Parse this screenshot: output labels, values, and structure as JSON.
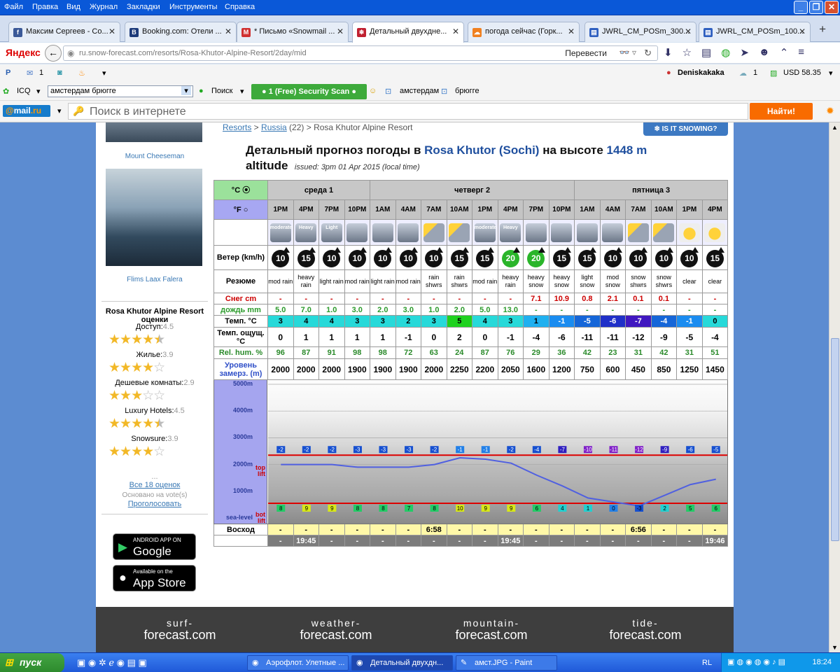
{
  "menu": [
    "Файл",
    "Правка",
    "Вид",
    "Журнал",
    "Закладки",
    "Инструменты",
    "Справка"
  ],
  "tabs": [
    {
      "label": "Максим Сергеев - Со...",
      "icon": "facebook-icon",
      "color": "#3b5998",
      "glyph": "f"
    },
    {
      "label": "Booking.com: Отели ...",
      "icon": "booking-icon",
      "color": "#1d3b7a",
      "glyph": "B"
    },
    {
      "label": "* Письмо «Snowmail ...",
      "icon": "mail-icon",
      "color": "#d03030",
      "glyph": "M"
    },
    {
      "label": "Детальный двухдне...",
      "icon": "snow-forecast-icon",
      "color": "#c02030",
      "glyph": "❄"
    },
    {
      "label": "погода сейчас (Горк...",
      "icon": "weather-icon",
      "color": "#f08020",
      "glyph": "☁"
    },
    {
      "label": "JWRL_CM_POSm_300...",
      "icon": "document-icon",
      "color": "#3060c0",
      "glyph": "▤"
    },
    {
      "label": "JWRL_CM_POSm_100...",
      "icon": "document-icon",
      "color": "#3060c0",
      "glyph": "▤"
    }
  ],
  "nav": {
    "yandex": "Яндекс",
    "url": "ru.snow-forecast.com/resorts/Rosa-Khutor-Alpine-Resort/2day/mid",
    "translate": "Перевести"
  },
  "bookmarks": {
    "mail_count": "1",
    "user": "Deniskakaka",
    "cloud_count": "1",
    "usd": "USD 58.35"
  },
  "toolbar3": {
    "icq": "ICQ",
    "search_select": "амстердам брюгге",
    "search": "Поиск",
    "security": "● 1 (Free) Security Scan ●",
    "q1": "амстердам",
    "q2": "брюгге"
  },
  "mailbar": {
    "logo_at": "@",
    "logo_rest": "mail",
    "logo_ru": ".ru",
    "search_placeholder": "Поиск в интернете",
    "find": "Найти!"
  },
  "left": {
    "cap1": "Mount Cheeseman",
    "cap2": "Flims Laax Falera",
    "rating_title": "Rosa Khutor Alpine Resort оценки",
    "ratings": [
      {
        "label": "Доступ:",
        "value": "4.5",
        "stars": 4.5
      },
      {
        "label": "Жилье:",
        "value": "3.9",
        "stars": 4
      },
      {
        "label": "Дешевые комнаты:",
        "value": "2.9",
        "stars": 3
      },
      {
        "label": "Luxury Hotels:",
        "value": "4.5",
        "stars": 4.5
      },
      {
        "label": "Snowsure:",
        "value": "3.9",
        "stars": 4
      }
    ],
    "dots": "...",
    "all": "Все 18 оценок",
    "based": "Основано на vote(s)",
    "vote": "Проголосовать",
    "android_small": "ANDROID APP ON",
    "android_big": "Google play",
    "apple_small": "Available on the",
    "apple_big": "App Store"
  },
  "header": {
    "crumb1": "Resorts",
    "sep1": " > ",
    "crumb2": "Russia",
    "count": " (22) > ",
    "crumb3": "Rosa Khutor Alpine Resort",
    "snowing": "❄ IS IT SNOWING?",
    "title_a": "Детальный прогноз погоды в ",
    "title_b": "Rosa Khutor (Sochi)",
    "title_c": " на высоте ",
    "title_d": "1448 m",
    "title_e": "altitude",
    "issued": "issued: 3pm 01 Apr 2015 (local time)"
  },
  "fc": {
    "unit_c": "°C ⦿",
    "unit_f": "°F ○",
    "days": [
      {
        "label": "среда 1",
        "span": 4
      },
      {
        "label": "четверг 2",
        "span": 8
      },
      {
        "label": "пятница 3",
        "span": 6
      }
    ],
    "times": [
      "1PM",
      "4PM",
      "7PM",
      "10PM",
      "1AM",
      "4AM",
      "7AM",
      "10AM",
      "1PM",
      "4PM",
      "7PM",
      "10PM",
      "1AM",
      "4AM",
      "7AM",
      "10AM",
      "1PM",
      "4PM"
    ],
    "icons": [
      "moderate",
      "heavy",
      "light",
      "rain",
      "rain",
      "rain",
      "psun",
      "psun",
      "moderate",
      "heavy",
      "snow",
      "snow",
      "snow",
      "snow",
      "psun",
      "psun",
      "sun",
      "sun"
    ],
    "icon_text": [
      "moderate",
      "Heavy",
      "Light",
      "",
      "",
      "",
      "",
      "",
      "moderate",
      "Heavy",
      "",
      "",
      "",
      "",
      "",
      "",
      "",
      ""
    ],
    "wind_label": "Ветер (km/h)",
    "wind": [
      "10",
      "15",
      "10",
      "10",
      "10",
      "10",
      "10",
      "15",
      "15",
      "20",
      "20",
      "15",
      "15",
      "10",
      "10",
      "10",
      "10",
      "15"
    ],
    "summary_label": "Резюме",
    "summary": [
      "mod rain",
      "heavy rain",
      "light rain",
      "mod rain",
      "light rain",
      "mod rain",
      "rain shwrs",
      "rain shwrs",
      "mod rain",
      "heavy rain",
      "heavy snow",
      "heavy snow",
      "light snow",
      "mod snow",
      "snow shwrs",
      "snow shwrs",
      "clear",
      "clear"
    ],
    "snow_label": "Снег cm",
    "snow": [
      "-",
      "-",
      "-",
      "-",
      "-",
      "-",
      "-",
      "-",
      "-",
      "-",
      "7.1",
      "10.9",
      "0.8",
      "2.1",
      "0.1",
      "0.1",
      "-",
      "-"
    ],
    "rain_label": "дождь mm",
    "rain": [
      "5.0",
      "7.0",
      "1.0",
      "3.0",
      "2.0",
      "3.0",
      "1.0",
      "2.0",
      "5.0",
      "13.0",
      "-",
      "-",
      "-",
      "-",
      "-",
      "-",
      "-",
      "-"
    ],
    "temp_label": "Темп. °C",
    "temp": [
      "3",
      "4",
      "4",
      "3",
      "3",
      "2",
      "3",
      "5",
      "4",
      "3",
      "1",
      "-1",
      "-5",
      "-6",
      "-7",
      "-4",
      "-1",
      "0"
    ],
    "feel_label": "Темп. ощущ. °C",
    "feel": [
      "0",
      "1",
      "1",
      "1",
      "1",
      "-1",
      "0",
      "2",
      "0",
      "-1",
      "-4",
      "-6",
      "-11",
      "-11",
      "-12",
      "-9",
      "-5",
      "-4"
    ],
    "hum_label": "Rel. hum. %",
    "hum": [
      "96",
      "87",
      "91",
      "98",
      "98",
      "72",
      "63",
      "24",
      "87",
      "76",
      "29",
      "36",
      "42",
      "23",
      "31",
      "42",
      "31",
      "51"
    ],
    "frz_label": "Уровень замерз. (m)",
    "frz": [
      "2000",
      "2000",
      "2000",
      "1900",
      "1900",
      "1900",
      "2000",
      "2250",
      "2200",
      "2050",
      "1600",
      "1200",
      "750",
      "600",
      "450",
      "850",
      "1250",
      "1450"
    ],
    "chart_axis": [
      "5000m",
      "4000m",
      "3000m",
      "2000m",
      "1000m",
      "sea-level"
    ],
    "chart_top": "top lift",
    "chart_bot": "bot lift",
    "chart_top_temps": [
      "-2",
      "-2",
      "-2",
      "-3",
      "-3",
      "-3",
      "-2",
      "-1",
      "-1",
      "-2",
      "-4",
      "-7",
      "-10",
      "-11",
      "-12",
      "-9",
      "-6",
      "-5"
    ],
    "chart_bot_temps": [
      "8",
      "9",
      "9",
      "8",
      "8",
      "7",
      "8",
      "10",
      "9",
      "9",
      "6",
      "4",
      "1",
      "0",
      "-3",
      "2",
      "5",
      "6"
    ],
    "rise_label": "Восход",
    "rise": [
      "-",
      "-",
      "-",
      "-",
      "-",
      "-",
      "6:58",
      "-",
      "-",
      "-",
      "-",
      "-",
      "-",
      "-",
      "6:56",
      "-",
      "-",
      "-"
    ],
    "set_label": "Закат",
    "set": [
      "-",
      "19:45",
      "-",
      "-",
      "-",
      "-",
      "-",
      "-",
      "-",
      "19:45",
      "-",
      "-",
      "-",
      "-",
      "-",
      "-",
      "-",
      "19:46"
    ]
  },
  "footer": [
    {
      "a": "surf-",
      "b": "forecast.com"
    },
    {
      "a": "weather-",
      "b": "forecast.com"
    },
    {
      "a": "mountain-",
      "b": "forecast.com"
    },
    {
      "a": "tide-",
      "b": "forecast.com"
    }
  ],
  "taskbar": {
    "start": "пуск",
    "tasks": [
      "Аэрофлот. Улетные ...",
      "Детальный двухдн...",
      "амст.JPG - Paint"
    ],
    "lang": "RL",
    "clock": "18:24"
  }
}
